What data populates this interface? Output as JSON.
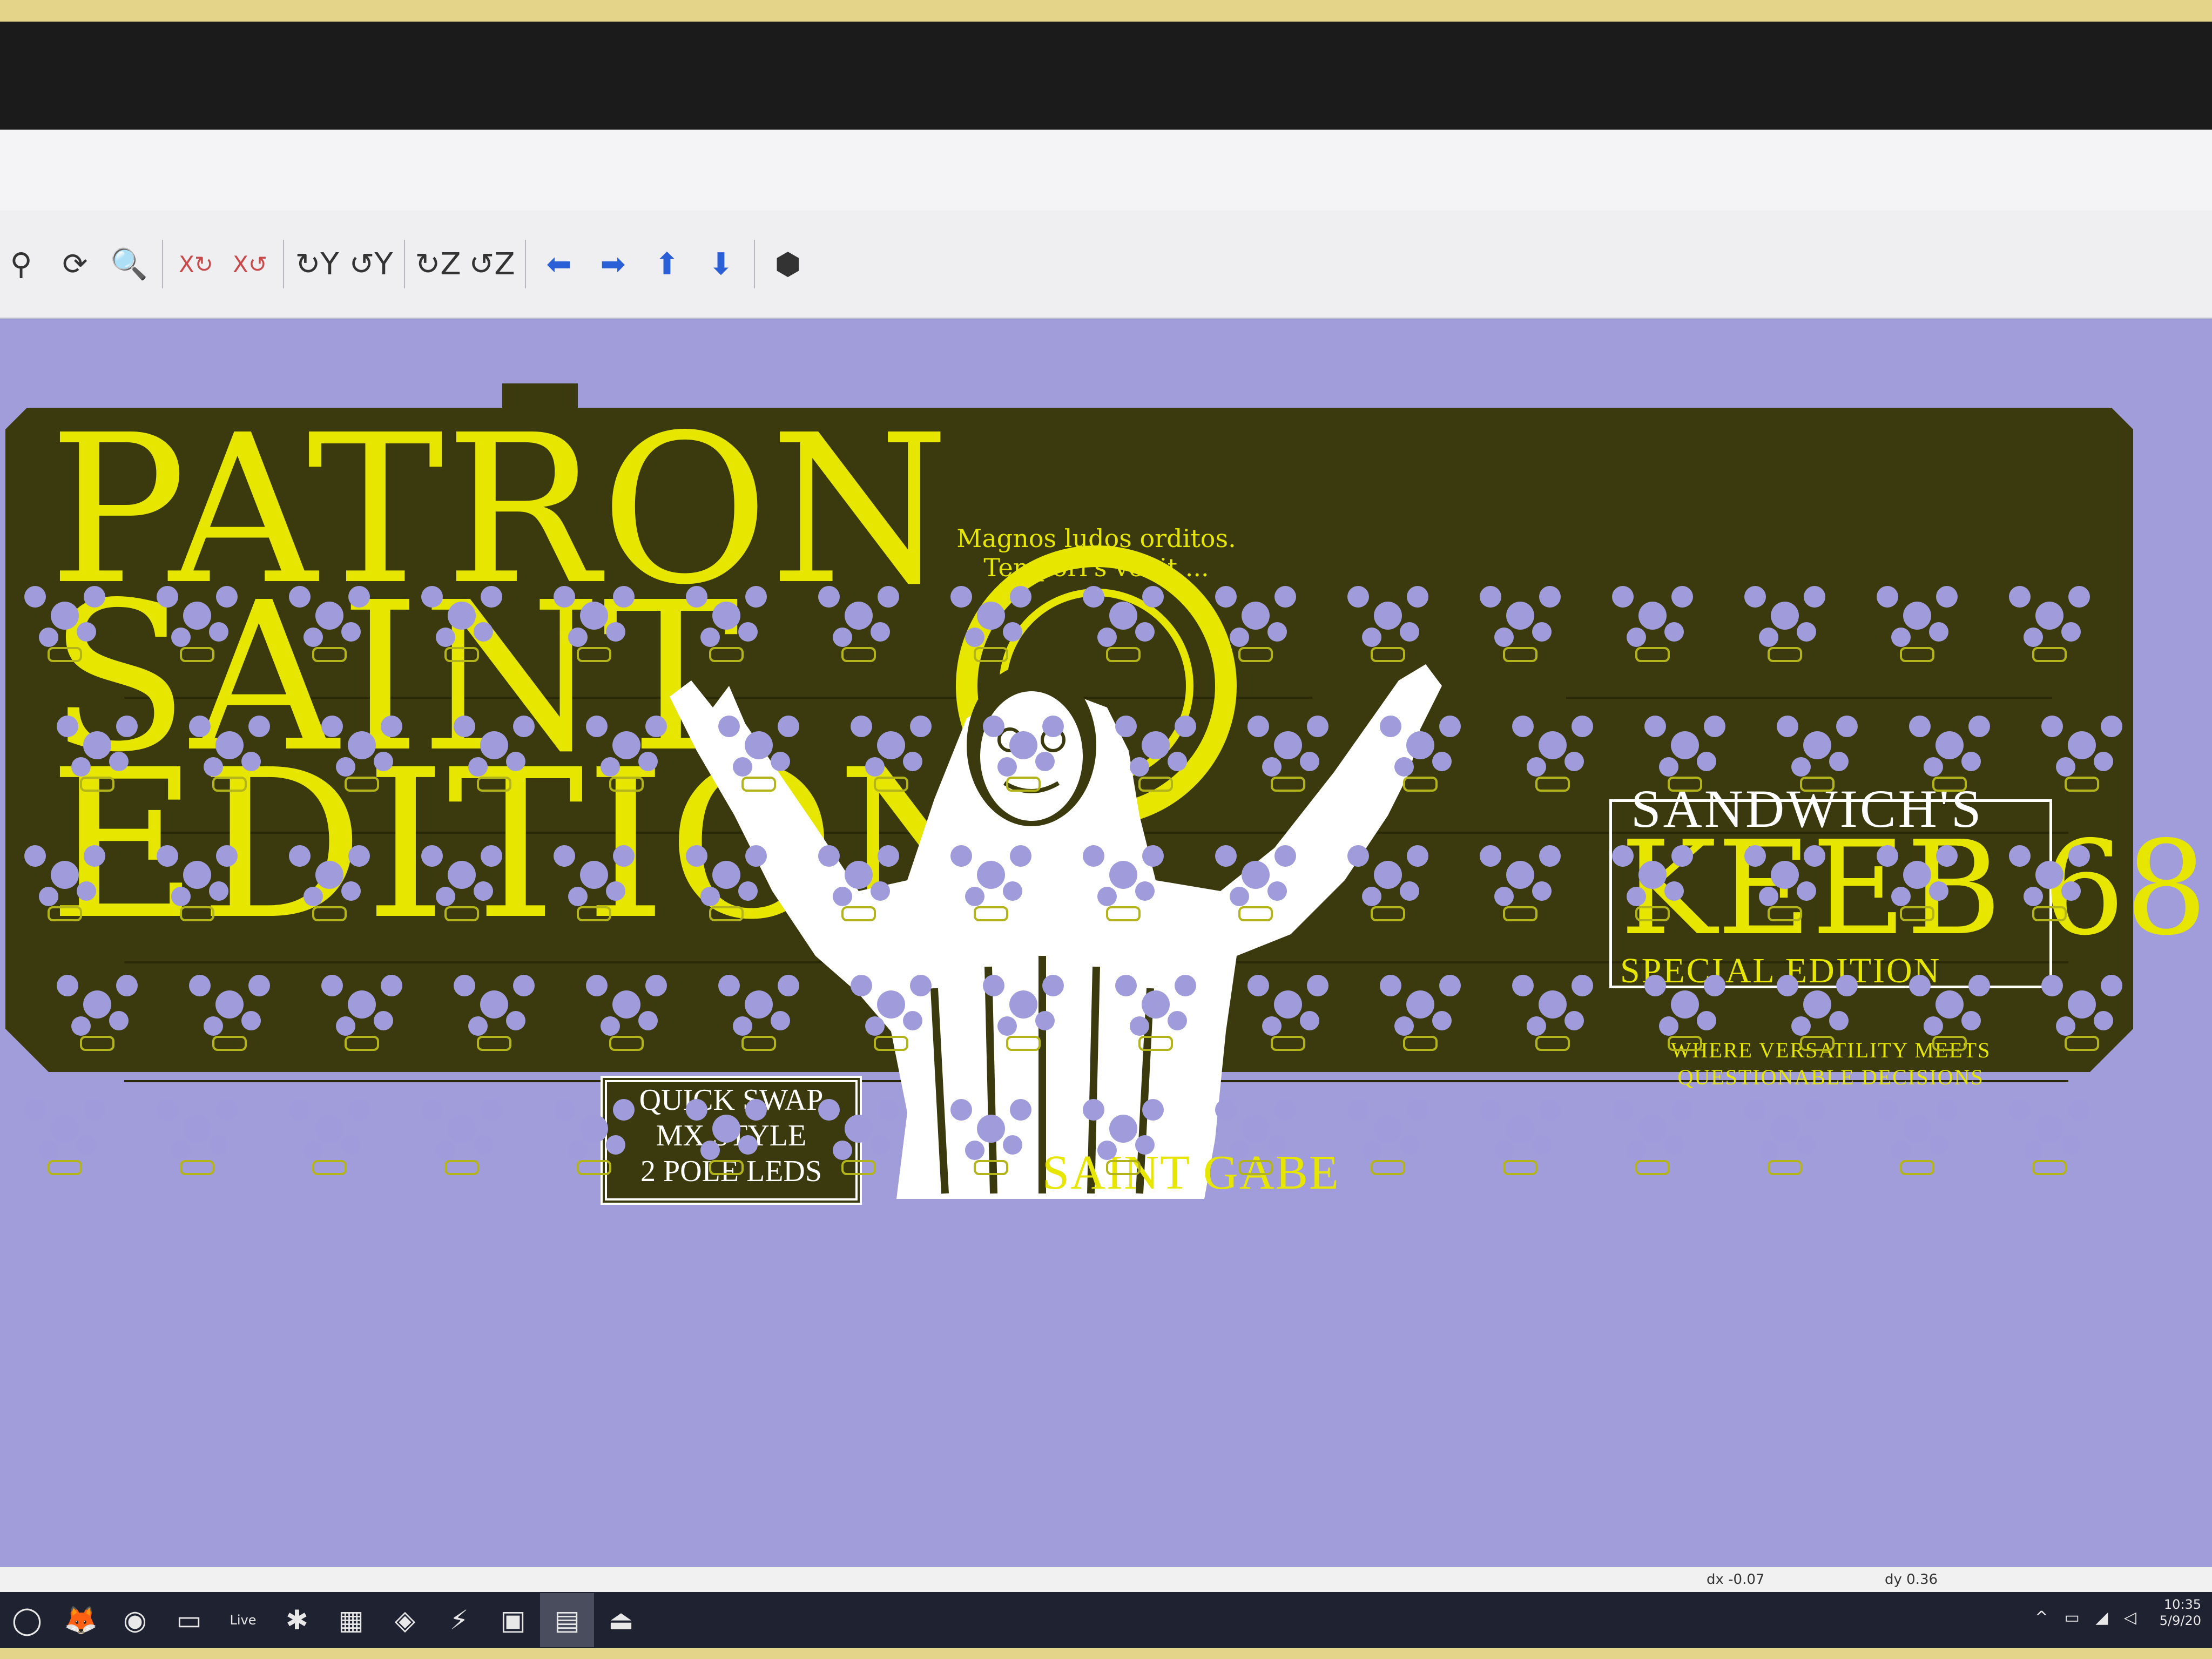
{
  "toolbar": {
    "buttons": [
      {
        "name": "zoom-in",
        "glyph": "⚲"
      },
      {
        "name": "refresh",
        "glyph": "⟳"
      },
      {
        "name": "zoom-fit",
        "glyph": "🔍"
      },
      {
        "name": "flip-x",
        "glyph": "X↻"
      },
      {
        "name": "flip-x-ccw",
        "glyph": "X↺"
      },
      {
        "name": "rotate-y",
        "glyph": "↻Y"
      },
      {
        "name": "rotate-y-ccw",
        "glyph": "↺Y"
      },
      {
        "name": "rotate-z",
        "glyph": "↻Z"
      },
      {
        "name": "rotate-z-ccw",
        "glyph": "↺Z"
      },
      {
        "name": "move-left",
        "glyph": "⬅"
      },
      {
        "name": "move-right",
        "glyph": "➡"
      },
      {
        "name": "move-up",
        "glyph": "⬆"
      },
      {
        "name": "move-down",
        "glyph": "⬇"
      },
      {
        "name": "3d-view",
        "glyph": "⬢"
      }
    ]
  },
  "board": {
    "title_lines": [
      "PATRON",
      "SAINT",
      "EDITION"
    ],
    "quick_swap": [
      "QUICK SWAP",
      "MX STYLE",
      "2 POLE LEDS"
    ],
    "sandwich": "SANDWICH'S",
    "keeb": "KEEB 68",
    "special": "SPECIAL EDITION",
    "tagline": [
      "WHERE VERSATILITY MEETS",
      "QUESTIONABLE DECISIONS"
    ],
    "saint_label": "SAINT GABE",
    "halo_text": "Magnos ludos orditos. Tempori's venit ..."
  },
  "colors": {
    "board": "#3a3a0e",
    "silkscreen_yellow": "#e6e600",
    "silkscreen_white": "#ffffff",
    "background": "#a19ddb"
  },
  "status": {
    "dx": "dx -0.07",
    "dy": "dy 0.36"
  },
  "taskbar": {
    "apps": [
      {
        "name": "search",
        "glyph": "◯"
      },
      {
        "name": "firefox",
        "glyph": "🦊"
      },
      {
        "name": "chrome",
        "glyph": "◉"
      },
      {
        "name": "terminal",
        "glyph": "▭"
      },
      {
        "name": "live",
        "glyph": "Live"
      },
      {
        "name": "tool",
        "glyph": "✱"
      },
      {
        "name": "calculator",
        "glyph": "▦"
      },
      {
        "name": "app-blue",
        "glyph": "◈"
      },
      {
        "name": "app-lightning",
        "glyph": "⚡"
      },
      {
        "name": "app-chat",
        "glyph": "▣"
      },
      {
        "name": "kicad",
        "glyph": "▤"
      },
      {
        "name": "app-arrow",
        "glyph": "⏏"
      }
    ],
    "tray_time": "10:35",
    "tray_date": "5/9/20"
  }
}
